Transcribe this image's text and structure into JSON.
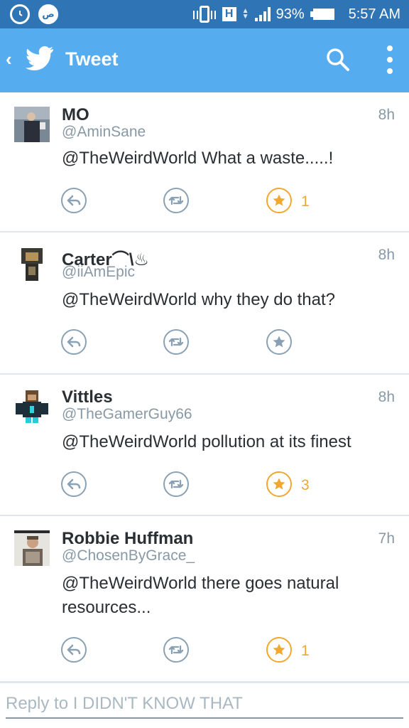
{
  "status_bar": {
    "battery": "93%",
    "time": "5:57 AM",
    "network": "H",
    "notification_icons": [
      "alarm-icon",
      "prayer-app-icon"
    ]
  },
  "app_bar": {
    "title": "Tweet",
    "icons": [
      "back-icon",
      "twitter-bird-icon",
      "search-icon",
      "overflow-menu-icon"
    ]
  },
  "tweets": [
    {
      "name": "MO",
      "handle": "@AminSane",
      "time": "8h",
      "text": "@TheWeirdWorld What a waste.....!",
      "favorited": true,
      "fav_count": "1"
    },
    {
      "name": "Carter⌒\\♨",
      "handle": "@iiAmEpic",
      "time": "8h",
      "text": "@TheWeirdWorld why they do that?",
      "favorited": false,
      "fav_count": ""
    },
    {
      "name": "Vittles",
      "handle": "@TheGamerGuy66",
      "time": "8h",
      "text": "@TheWeirdWorld pollution at its finest",
      "favorited": true,
      "fav_count": "3"
    },
    {
      "name": "Robbie Huffman",
      "handle": "@ChosenByGrace_",
      "time": "7h",
      "text": "@TheWeirdWorld there goes natural resources...",
      "favorited": true,
      "fav_count": "1"
    }
  ],
  "reply": {
    "placeholder": "Reply to I DIDN'T KNOW THAT"
  },
  "colors": {
    "status_bar": "#2f75b5",
    "app_bar": "#55acee",
    "favorite": "#f0a830",
    "action_icon": "#8aa1b4",
    "secondary_text": "#8899a6"
  }
}
